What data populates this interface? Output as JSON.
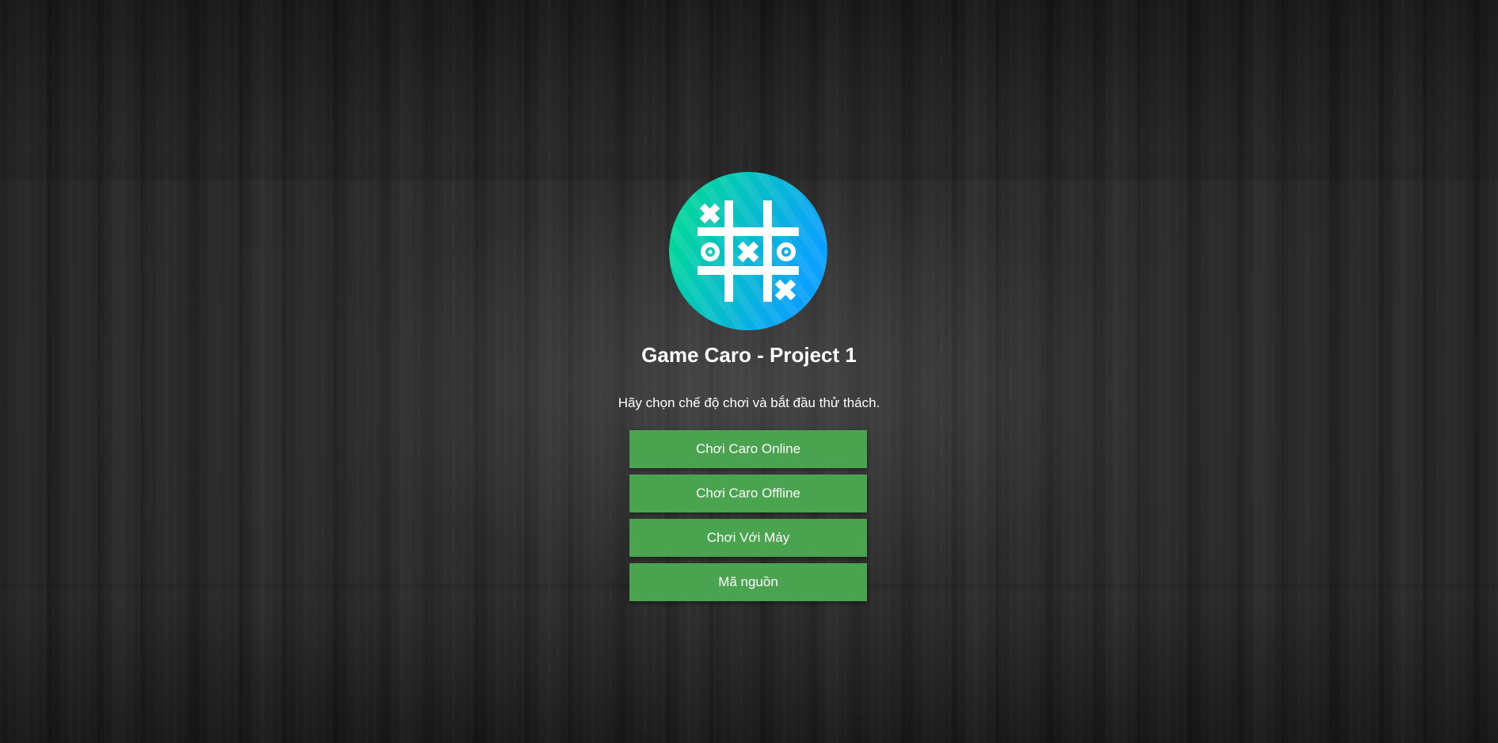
{
  "game": {
    "title": "Game Caro - Project 1",
    "subtitle": "Hãy chọn chế độ chơi và bắt đầu thử thách.",
    "logo_icon": "tic-tac-toe-logo-icon"
  },
  "menu": {
    "buttons": [
      {
        "label": "Chơi Caro Online"
      },
      {
        "label": "Chơi Caro Offline"
      },
      {
        "label": "Chơi Với Máy"
      },
      {
        "label": "Mã nguồn"
      }
    ]
  },
  "colors": {
    "button": "#4aa34e",
    "logo_gradient_start": "#00e08a",
    "logo_gradient_end": "#0aa0ff",
    "background": "#2a2a2a",
    "text": "#ffffff"
  }
}
